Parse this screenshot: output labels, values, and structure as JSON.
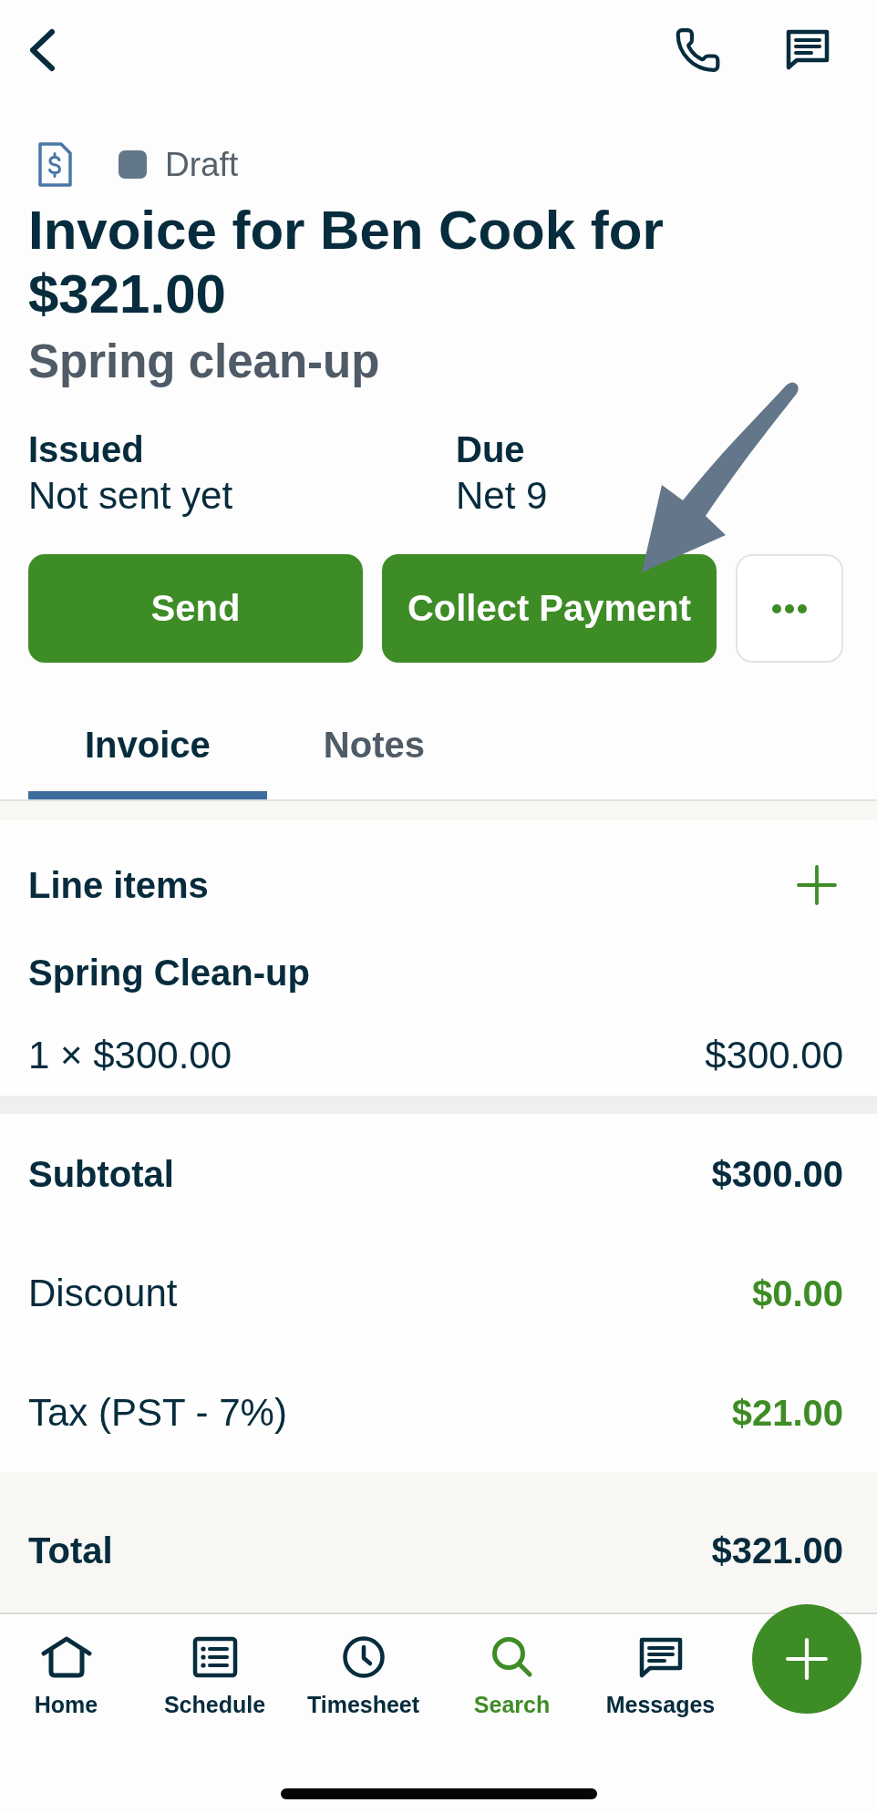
{
  "status": {
    "label": "Draft"
  },
  "title": "Invoice for Ben Cook for $321.00",
  "subtitle": "Spring clean-up",
  "details": [
    {
      "label": "Issued",
      "value": "Not sent yet"
    },
    {
      "label": "Due",
      "value": "Net 9"
    }
  ],
  "actions": [
    {
      "kind": "primary",
      "label": "Send"
    },
    {
      "kind": "primary",
      "label": "Collect Payment"
    },
    {
      "kind": "more"
    }
  ],
  "tabs": [
    {
      "label": "Invoice",
      "selected": true
    },
    {
      "label": "Notes",
      "selected": false
    }
  ],
  "line_items": {
    "title": "Line items",
    "items": [
      {
        "name": "Spring Clean-up",
        "quantity": "1 × $300.00",
        "amount": "$300.00"
      }
    ]
  },
  "summary": [
    {
      "kind": "subtotal",
      "label": "Subtotal",
      "value": "$300.00"
    },
    {
      "kind": "adjustment",
      "label": "Discount",
      "value": "$0.00"
    },
    {
      "kind": "adjustment",
      "label": "Tax (PST - 7%)",
      "value": "$21.00"
    }
  ],
  "total": {
    "label": "Total",
    "value": "$321.00"
  },
  "bottom_nav": [
    {
      "label": "Home",
      "selected": false
    },
    {
      "label": "Schedule",
      "selected": false
    },
    {
      "label": "Timesheet",
      "selected": false
    },
    {
      "label": "Search",
      "selected": true
    },
    {
      "label": "Messages",
      "selected": false
    }
  ]
}
